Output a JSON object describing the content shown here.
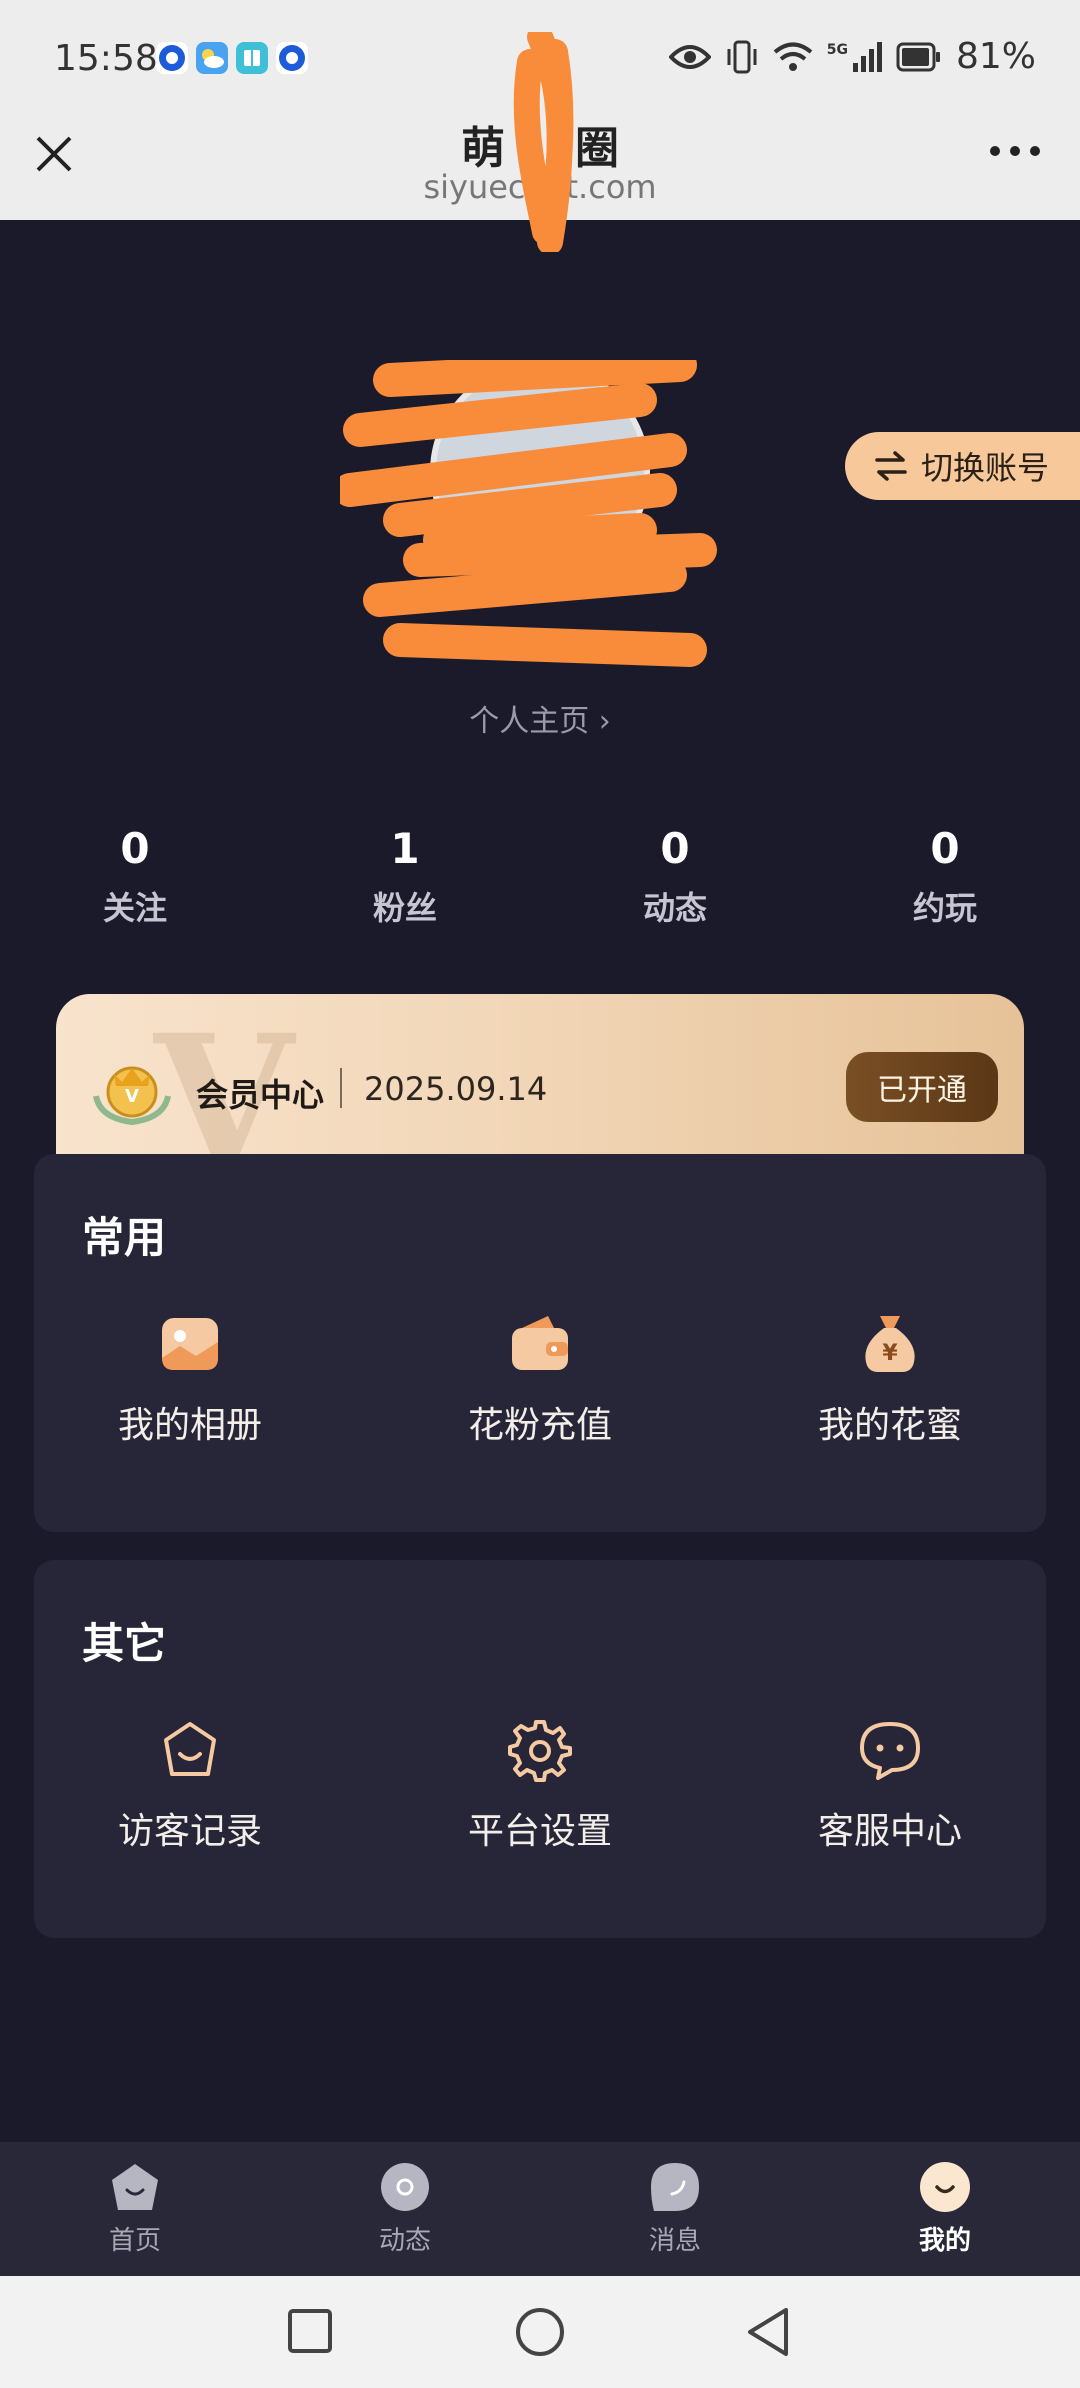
{
  "status_bar": {
    "time": "15:58",
    "network": "5G",
    "battery": "81%",
    "icons": [
      "notification-app-icon",
      "weather-app-icon",
      "reader-app-icon",
      "notification-app-icon",
      "eye-icon",
      "vibrate-icon",
      "wifi-icon",
      "signal-icon",
      "battery-icon"
    ]
  },
  "browser": {
    "title": "萌",
    "title_tail": "圈",
    "url": "siyuec",
    "url_tail": "t.com"
  },
  "profile": {
    "switch_account": "切换账号",
    "homepage_link": "个人主页 ›"
  },
  "stats": [
    {
      "value": "0",
      "label": "关注"
    },
    {
      "value": "1",
      "label": "粉丝"
    },
    {
      "value": "0",
      "label": "动态"
    },
    {
      "value": "0",
      "label": "约玩"
    }
  ],
  "vip": {
    "watermark": "V",
    "title": "会员中心",
    "date": "2025.09.14",
    "button": "已开通"
  },
  "common": {
    "title": "常用",
    "items": [
      {
        "label": "我的相册",
        "icon": "photo-album-icon"
      },
      {
        "label": "花粉充值",
        "icon": "wallet-icon"
      },
      {
        "label": "我的花蜜",
        "icon": "money-bag-icon"
      }
    ]
  },
  "other": {
    "title": "其它",
    "items": [
      {
        "label": "访客记录",
        "icon": "visitor-icon"
      },
      {
        "label": "平台设置",
        "icon": "settings-gear-icon"
      },
      {
        "label": "客服中心",
        "icon": "chat-bubble-icon"
      }
    ]
  },
  "tabs": [
    {
      "label": "首页",
      "icon": "home-icon"
    },
    {
      "label": "动态",
      "icon": "moments-icon"
    },
    {
      "label": "消息",
      "icon": "message-icon"
    },
    {
      "label": "我的",
      "icon": "me-icon",
      "active": true
    }
  ],
  "colors": {
    "page_bg": "#1b1a2a",
    "card_bg": "#262638",
    "accent": "#f6c89a",
    "vip_button": "#6a4420"
  }
}
